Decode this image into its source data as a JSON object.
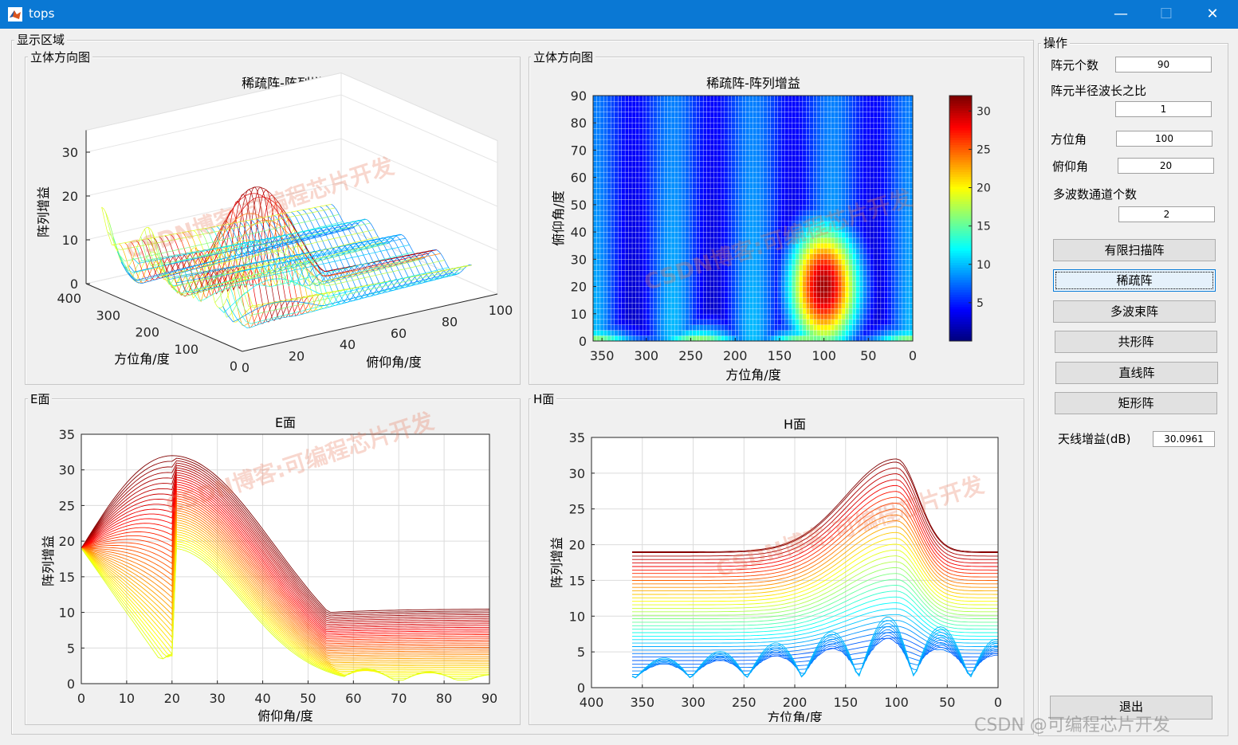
{
  "window": {
    "title": "tops",
    "minimize": "—",
    "maximize": "☐",
    "close": "✕"
  },
  "display_panel": {
    "title": "显示区域"
  },
  "panels": {
    "tl": {
      "title": "立体方向图"
    },
    "tr": {
      "title": "立体方向图"
    },
    "bl": {
      "title": "E面"
    },
    "br": {
      "title": "H面"
    }
  },
  "ops_panel": {
    "title": "操作",
    "element_count": {
      "label": "阵元个数",
      "value": "90"
    },
    "radius_ratio": {
      "label": "阵元半径波长之比",
      "value": "1"
    },
    "azimuth": {
      "label": "方位角",
      "value": "100"
    },
    "elevation": {
      "label": "俯仰角",
      "value": "20"
    },
    "channels": {
      "label": "多波数通道个数",
      "value": "2"
    },
    "buttons": {
      "finite_scan": "有限扫描阵",
      "sparse": "稀疏阵",
      "multibeam": "多波束阵",
      "conformal": "共形阵",
      "linear": "直线阵",
      "rectangular": "矩形阵"
    },
    "antenna_gain": {
      "label": "天线增益(dB)",
      "value": "30.0961"
    },
    "exit": "退出"
  },
  "watermarks": {
    "text": "CSDN博客:可编程芯片开发",
    "corner": "CSDN @可编程芯片开发"
  },
  "chart_data": [
    {
      "type": "surface",
      "title": "稀疏阵-阵列增益",
      "xlabel": "俯仰角/度",
      "ylabel": "方位角/度",
      "zlabel": "阵列增益",
      "xticks": [
        "0",
        "20",
        "40",
        "60",
        "80",
        "100"
      ],
      "yticks": [
        "0",
        "100",
        "200",
        "300",
        "400"
      ],
      "zticks": [
        "0",
        "10",
        "20",
        "30"
      ],
      "peak": {
        "azimuth": 100,
        "elevation": 20,
        "gain": 31
      },
      "grid": true
    },
    {
      "type": "heatmap",
      "title": "稀疏阵-阵列增益",
      "xlabel": "方位角/度",
      "ylabel": "俯仰角/度",
      "xticks": [
        "350",
        "300",
        "250",
        "200",
        "150",
        "100",
        "50",
        "0"
      ],
      "yticks": [
        "0",
        "10",
        "20",
        "30",
        "40",
        "50",
        "60",
        "70",
        "80",
        "90"
      ],
      "colorbar_ticks": [
        "5",
        "10",
        "15",
        "20",
        "25",
        "30"
      ],
      "xlim": [
        0,
        360
      ],
      "ylim": [
        0,
        90
      ],
      "clim": [
        0,
        32
      ],
      "colormap": "jet",
      "peak": {
        "azimuth": 100,
        "elevation": 20,
        "gain": 31
      }
    },
    {
      "type": "line",
      "title": "E面",
      "xlabel": "俯仰角/度",
      "ylabel": "阵列增益",
      "xticks": [
        "0",
        "10",
        "20",
        "30",
        "40",
        "50",
        "60",
        "70",
        "80",
        "90"
      ],
      "yticks": [
        "0",
        "5",
        "10",
        "15",
        "20",
        "25",
        "30",
        "35"
      ],
      "xlim": [
        0,
        90
      ],
      "ylim": [
        0,
        35
      ],
      "peak": {
        "x": 20,
        "y": 32
      },
      "start_value": 19,
      "colormap": "jet",
      "grid": true
    },
    {
      "type": "line",
      "title": "H面",
      "xlabel": "方位角/度",
      "ylabel": "阵列增益",
      "xticks": [
        "400",
        "350",
        "300",
        "250",
        "200",
        "150",
        "100",
        "50",
        "0"
      ],
      "yticks": [
        "0",
        "5",
        "10",
        "15",
        "20",
        "25",
        "30",
        "35"
      ],
      "xlim": [
        0,
        400
      ],
      "ylim": [
        0,
        35
      ],
      "peak": {
        "x": 100,
        "y": 32
      },
      "plateau_value": 19,
      "colormap": "jet",
      "grid": true
    }
  ]
}
